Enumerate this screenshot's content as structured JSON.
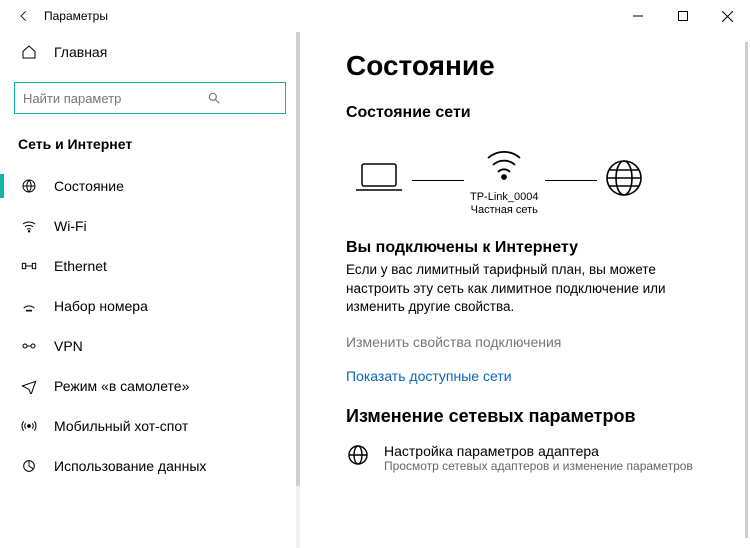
{
  "titlebar": {
    "title": "Параметры"
  },
  "sidebar": {
    "home_label": "Главная",
    "search_placeholder": "Найти параметр",
    "section_label": "Сеть и Интернет",
    "items": [
      {
        "label": "Состояние"
      },
      {
        "label": "Wi-Fi"
      },
      {
        "label": "Ethernet"
      },
      {
        "label": "Набор номера"
      },
      {
        "label": "VPN"
      },
      {
        "label": "Режим «в самолете»"
      },
      {
        "label": "Мобильный хот-спот"
      },
      {
        "label": "Использование данных"
      }
    ]
  },
  "main": {
    "title": "Состояние",
    "net_status_heading": "Состояние сети",
    "net_name": "TP-Link_0004",
    "net_type": "Частная сеть",
    "connected_title": "Вы подключены к Интернету",
    "connected_desc": "Если у вас лимитный тарифный план, вы можете настроить эту сеть как лимитное подключение или изменить другие свойства.",
    "change_props": "Изменить свойства подключения",
    "show_networks": "Показать доступные сети",
    "change_net_params": "Изменение сетевых параметров",
    "adapter_title": "Настройка параметров адаптера",
    "adapter_desc": "Просмотр сетевых адаптеров и изменение параметров"
  }
}
